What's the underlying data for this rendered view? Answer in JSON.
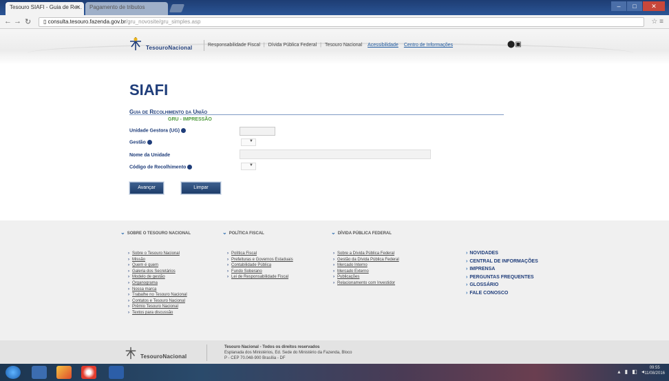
{
  "browser": {
    "active_tab_title": "Tesouro SIAFI - Guia de Re...",
    "inactive_tab_title": "Pagamento de tributos",
    "url_host": "consulta.tesouro.fazenda.gov.br",
    "url_path": "/gru_novosite/gru_simples.asp"
  },
  "header": {
    "logo_text": "TesouroNacional",
    "links": [
      "Responsabilidade Fiscal",
      "Dívida Pública Federal",
      "Tesouro Nacional"
    ],
    "aux_links": [
      "Acessibilidade",
      "Centro de Informações"
    ]
  },
  "main": {
    "title": "SIAFI",
    "form_title": "Guia de Recolhimento da União",
    "form_subtitle": "GRU - IMPRESSÃO",
    "labels": {
      "ug": "Unidade Gestora (UG)",
      "gestao": "Gestão",
      "nome_unidade": "Nome da Unidade",
      "codigo": "Código de Recolhimento"
    },
    "buttons": {
      "advance": "Avançar",
      "clear": "Limpar"
    }
  },
  "footer": {
    "col1": {
      "heading": "SOBRE O TESOURO NACIONAL",
      "items": [
        "Sobre o Tesouro Nacional",
        "Missão",
        "Quem é quem",
        "Galeria dos Secretários",
        "Modelo de gestão",
        "Organograma",
        "Nossa marca",
        "Trabalhe no Tesouro Nacional",
        "Contatos e Tesouro Nacional",
        "Prêmio Tesouro Nacional",
        "Textos para discussão"
      ]
    },
    "col2": {
      "heading": "POLÍTICA FISCAL",
      "items": [
        "Política Fiscal",
        "Prefeituras e Governos Estaduais",
        "Contabilidade Pública",
        "Fundo Soberano",
        "Lei de Responsabilidade Fiscal"
      ]
    },
    "col3": {
      "heading": "DÍVIDA PÚBLICA FEDERAL",
      "items": [
        "Sobre a Dívida Pública Federal",
        "Gestão da Dívida Pública Federal",
        "Mercado Interno",
        "Mercado Externo",
        "Publicações",
        "Relacionamento com Investidor"
      ]
    },
    "quick_links": [
      "NOVIDADES",
      "CENTRAL DE INFORMAÇÕES",
      "IMPRENSA",
      "PERGUNTAS FREQUENTES",
      "GLOSSÁRIO",
      "FALE CONOSCO"
    ],
    "bottom_logo_text": "TesouroNacional",
    "bottom_info": [
      "Tesouro Nacional - Todos os direitos reservados",
      "Esplanada dos Ministérios, Ed. Sede do Ministério da Fazenda, Bloco",
      "P - CEP 70.048-900 Brasília - DF"
    ]
  },
  "taskbar": {
    "clock_time": "09:55",
    "clock_date": "11/08/2016"
  }
}
